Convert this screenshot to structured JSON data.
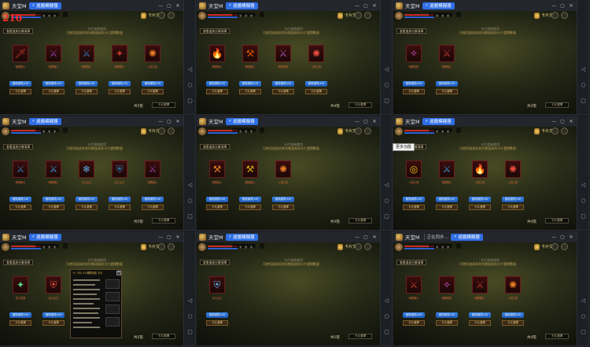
{
  "app_title": "天堂M",
  "speed_button_label": "遊戲模擬器",
  "badge_text": "卡片交換",
  "menu_button_label": "查看道具分解清單",
  "hint_line_1": "卡片道具使用",
  "hint_line_2": "可使用道具與其所需道具與卡片選擇數量",
  "card_button_blue": "變換道具(x4)",
  "card_button_gold": "卡片選擇",
  "footer_button": "卡片選擇",
  "overlay_tag": "210",
  "tooltip": "更多功能",
  "tab_extra": "正在同步...",
  "window_controls": [
    "—",
    "▢",
    "✕"
  ],
  "sidebar_icons": [
    "◁",
    "○",
    "▢"
  ],
  "popup_title": "+1 卡片 4人團隊加成 卡片",
  "panels": [
    {
      "id": "p1",
      "count": "共5張",
      "items": [
        {
          "name": "暗黑騎士",
          "icon": "🗡",
          "color": "#c0392b"
        },
        {
          "name": "暗黑騎士",
          "icon": "⚔",
          "color": "#8e44ad"
        },
        {
          "name": "暗黑騎士",
          "icon": "⚔",
          "color": "#2980b9"
        },
        {
          "name": "暗黑騎士",
          "icon": "✦",
          "color": "#c0392b"
        },
        {
          "name": "火焰之影",
          "icon": "✺",
          "color": "#e67e22"
        }
      ]
    },
    {
      "id": "p2",
      "count": "共4張",
      "items": [
        {
          "name": "鋼鐵戰士",
          "icon": "🔥",
          "color": "#e67e22"
        },
        {
          "name": "鋼鐵戰士",
          "icon": "⚒",
          "color": "#d35400"
        },
        {
          "name": "暗黑妖精",
          "icon": "⚔",
          "color": "#9b59b6"
        },
        {
          "name": "火焰之影",
          "icon": "✺",
          "color": "#e74c3c"
        }
      ]
    },
    {
      "id": "p3",
      "count": "共2張",
      "items": [
        {
          "name": "暗黑妖精",
          "icon": "✧",
          "color": "#d65cd6"
        },
        {
          "name": "暗黑騎士",
          "icon": "⚔",
          "color": "#c0392b"
        }
      ]
    },
    {
      "id": "p4",
      "count": "共5張",
      "items": [
        {
          "name": "暗黑騎士",
          "icon": "⚔",
          "color": "#2980b9"
        },
        {
          "name": "暗黑騎士",
          "icon": "⚔",
          "color": "#3498db"
        },
        {
          "name": "冰之女王",
          "icon": "❄",
          "color": "#5dade2"
        },
        {
          "name": "冰之女王",
          "icon": "⛨",
          "color": "#2e86c1"
        },
        {
          "name": "暗黑騎士",
          "icon": "⚔",
          "color": "#8e44ad"
        }
      ]
    },
    {
      "id": "p5",
      "count": "共3張",
      "items": [
        {
          "name": "鋼鐵戰士",
          "icon": "⚒",
          "color": "#e67e22"
        },
        {
          "name": "鋼鐵戰士",
          "icon": "⚒",
          "color": "#d4ac0d"
        },
        {
          "name": "火焰之影",
          "icon": "✺",
          "color": "#e67e22"
        }
      ]
    },
    {
      "id": "p6",
      "count": "共4張",
      "items": [
        {
          "name": "火焰之環",
          "icon": "◎",
          "color": "#f1c40f"
        },
        {
          "name": "暗黑騎士",
          "icon": "⚔",
          "color": "#3498db"
        },
        {
          "name": "火焰之影",
          "icon": "🔥",
          "color": "#e67e22"
        },
        {
          "name": "火焰之影",
          "icon": "✺",
          "color": "#e74c3c"
        }
      ]
    },
    {
      "id": "p7",
      "count": "共2張",
      "items": [
        {
          "name": "風之精靈",
          "icon": "✦",
          "color": "#58d68d"
        },
        {
          "name": "冰之女王",
          "icon": "⛨",
          "color": "#e74c3c"
        }
      ]
    },
    {
      "id": "p8",
      "count": "共1張",
      "items": [
        {
          "name": "冰之女王",
          "icon": "⛨",
          "color": "#5dade2"
        }
      ]
    },
    {
      "id": "p9",
      "count": "共4張",
      "items": [
        {
          "name": "暗黑騎士",
          "icon": "⚔",
          "color": "#c0392b"
        },
        {
          "name": "暗黑妖精",
          "icon": "✧",
          "color": "#d65cd6"
        },
        {
          "name": "暗黑騎士",
          "icon": "⚔",
          "color": "#c0392b"
        },
        {
          "name": "火焰之影",
          "icon": "✺",
          "color": "#e67e22"
        }
      ]
    }
  ]
}
